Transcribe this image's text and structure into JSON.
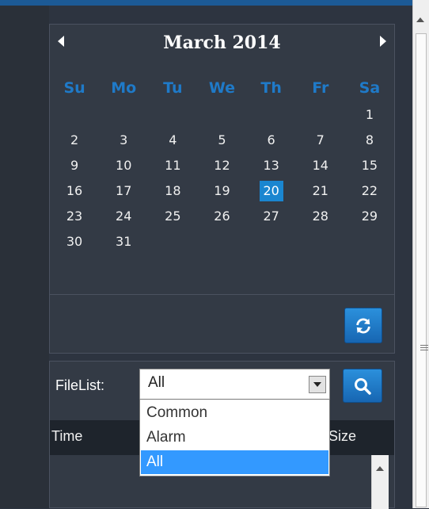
{
  "calendar": {
    "month_title": "March 2014",
    "weekdays": [
      "Su",
      "Mo",
      "Tu",
      "We",
      "Th",
      "Fr",
      "Sa"
    ],
    "weeks": [
      [
        "",
        "",
        "",
        "",
        "",
        "",
        "1"
      ],
      [
        "2",
        "3",
        "4",
        "5",
        "6",
        "7",
        "8"
      ],
      [
        "9",
        "10",
        "11",
        "12",
        "13",
        "14",
        "15"
      ],
      [
        "16",
        "17",
        "18",
        "19",
        "20",
        "21",
        "22"
      ],
      [
        "23",
        "24",
        "25",
        "26",
        "27",
        "28",
        "29"
      ],
      [
        "30",
        "31",
        "",
        "",
        "",
        "",
        ""
      ]
    ],
    "selected_day": "20",
    "refresh_icon": "refresh-icon"
  },
  "filelist": {
    "label": "FileList:",
    "selected_value": "All",
    "options": [
      "Common",
      "Alarm",
      "All"
    ],
    "search_icon": "search-icon",
    "columns": [
      "Time",
      "Size"
    ]
  },
  "colors": {
    "accent": "#1a86d0",
    "weekday_header": "#1f7ac8",
    "panel_bg": "#333a45",
    "selection_bg": "#3399ff"
  }
}
